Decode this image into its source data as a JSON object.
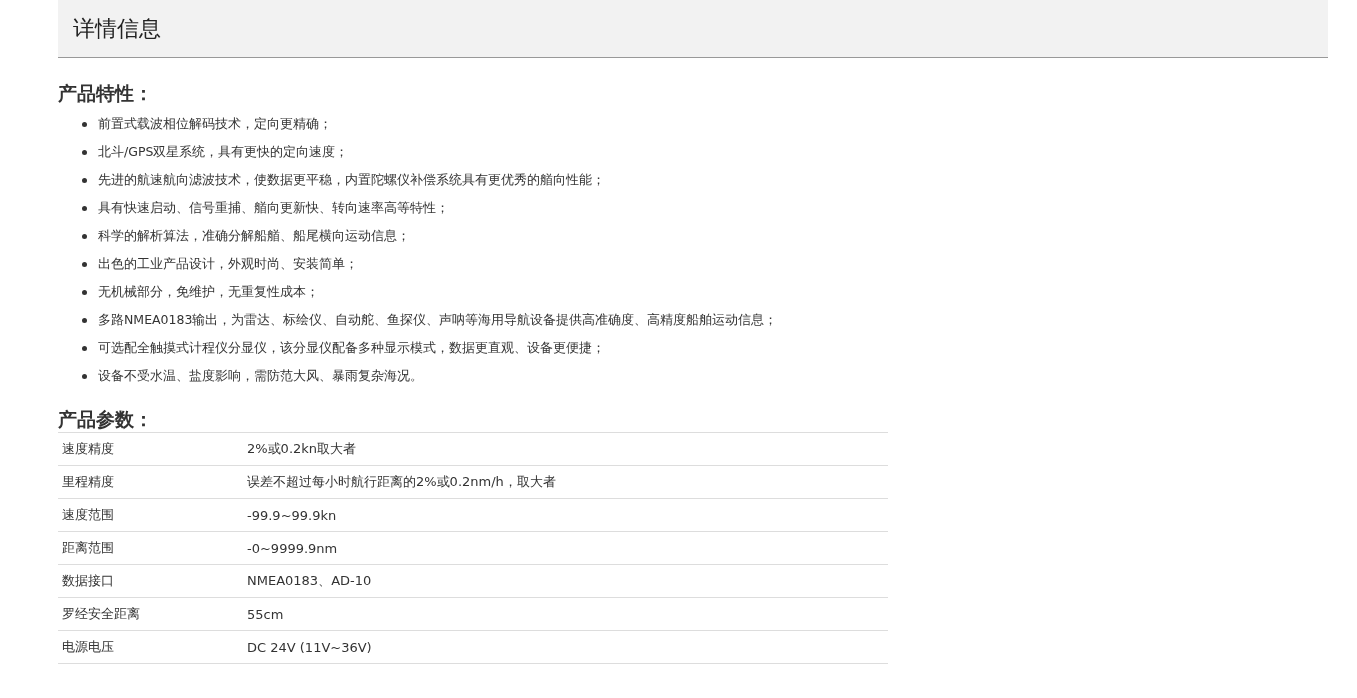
{
  "header": {
    "title": "详情信息"
  },
  "features": {
    "heading": "产品特性：",
    "items": [
      "前置式载波相位解码技术，定向更精确；",
      "北斗/GPS双星系统，具有更快的定向速度；",
      "先进的航速航向滤波技术，使数据更平稳，内置陀螺仪补偿系统具有更优秀的艏向性能；",
      "具有快速启动、信号重捕、艏向更新快、转向速率高等特性；",
      "科学的解析算法，准确分解船艏、船尾横向运动信息；",
      "出色的工业产品设计，外观时尚、安装简单；",
      "无机械部分，免维护，无重复性成本；",
      "多路NMEA0183输出，为雷达、标绘仪、自动舵、鱼探仪、声呐等海用导航设备提供高准确度、高精度船舶运动信息；",
      "可选配全触摸式计程仪分显仪，该分显仪配备多种显示模式，数据更直观、设备更便捷；",
      "设备不受水温、盐度影响，需防范大风、暴雨复杂海况。"
    ]
  },
  "parameters": {
    "heading": "产品参数：",
    "rows": [
      {
        "name": "速度精度",
        "value": "2%或0.2kn取大者"
      },
      {
        "name": "里程精度",
        "value": "误差不超过每小时航行距离的2%或0.2nm/h，取大者"
      },
      {
        "name": "速度范围",
        "value": "-99.9~99.9kn"
      },
      {
        "name": "距离范围",
        "value": "-0~9999.9nm"
      },
      {
        "name": "数据接口",
        "value": "NMEA0183、AD-10"
      },
      {
        "name": "罗经安全距离",
        "value": "55cm"
      },
      {
        "name": "电源电压",
        "value": "DC 24V (11V~36V)"
      }
    ]
  }
}
